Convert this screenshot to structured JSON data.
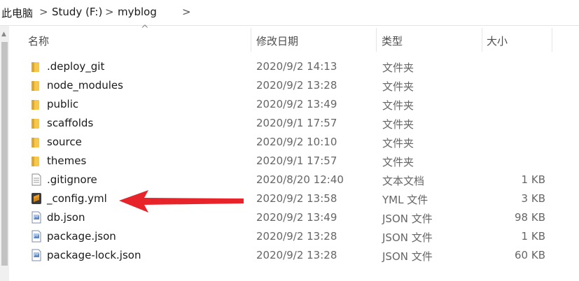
{
  "breadcrumb": {
    "items": [
      "此电脑",
      "Study (F:)",
      "myblog"
    ],
    "separator": ">",
    "trailing_separator": ">"
  },
  "columns": {
    "name": "名称",
    "date": "修改日期",
    "type": "类型",
    "size": "大小",
    "sort_indicator": "^"
  },
  "files": [
    {
      "name": ".deploy_git",
      "date": "2020/9/2 14:13",
      "type": "文件夹",
      "size": "",
      "icon": "folder-icon"
    },
    {
      "name": "node_modules",
      "date": "2020/9/2 13:28",
      "type": "文件夹",
      "size": "",
      "icon": "folder-icon"
    },
    {
      "name": "public",
      "date": "2020/9/2 13:49",
      "type": "文件夹",
      "size": "",
      "icon": "folder-icon"
    },
    {
      "name": "scaffolds",
      "date": "2020/9/1 17:57",
      "type": "文件夹",
      "size": "",
      "icon": "folder-icon"
    },
    {
      "name": "source",
      "date": "2020/9/2 10:10",
      "type": "文件夹",
      "size": "",
      "icon": "folder-icon"
    },
    {
      "name": "themes",
      "date": "2020/9/1 17:57",
      "type": "文件夹",
      "size": "",
      "icon": "folder-icon"
    },
    {
      "name": ".gitignore",
      "date": "2020/8/20 12:40",
      "type": "文本文档",
      "size": "1 KB",
      "icon": "text-file-icon"
    },
    {
      "name": "_config.yml",
      "date": "2020/9/2 13:58",
      "type": "YML 文件",
      "size": "3 KB",
      "icon": "sublime-file-icon"
    },
    {
      "name": "db.json",
      "date": "2020/9/2 13:49",
      "type": "JSON 文件",
      "size": "98 KB",
      "icon": "json-file-icon"
    },
    {
      "name": "package.json",
      "date": "2020/9/2 13:28",
      "type": "JSON 文件",
      "size": "1 KB",
      "icon": "json-file-icon"
    },
    {
      "name": "package-lock.json",
      "date": "2020/9/2 13:28",
      "type": "JSON 文件",
      "size": "60 KB",
      "icon": "json-file-icon"
    }
  ],
  "colors": {
    "folder": "#f5c84c",
    "arrow": "#e8242b",
    "sublime": "#f39a1a"
  }
}
